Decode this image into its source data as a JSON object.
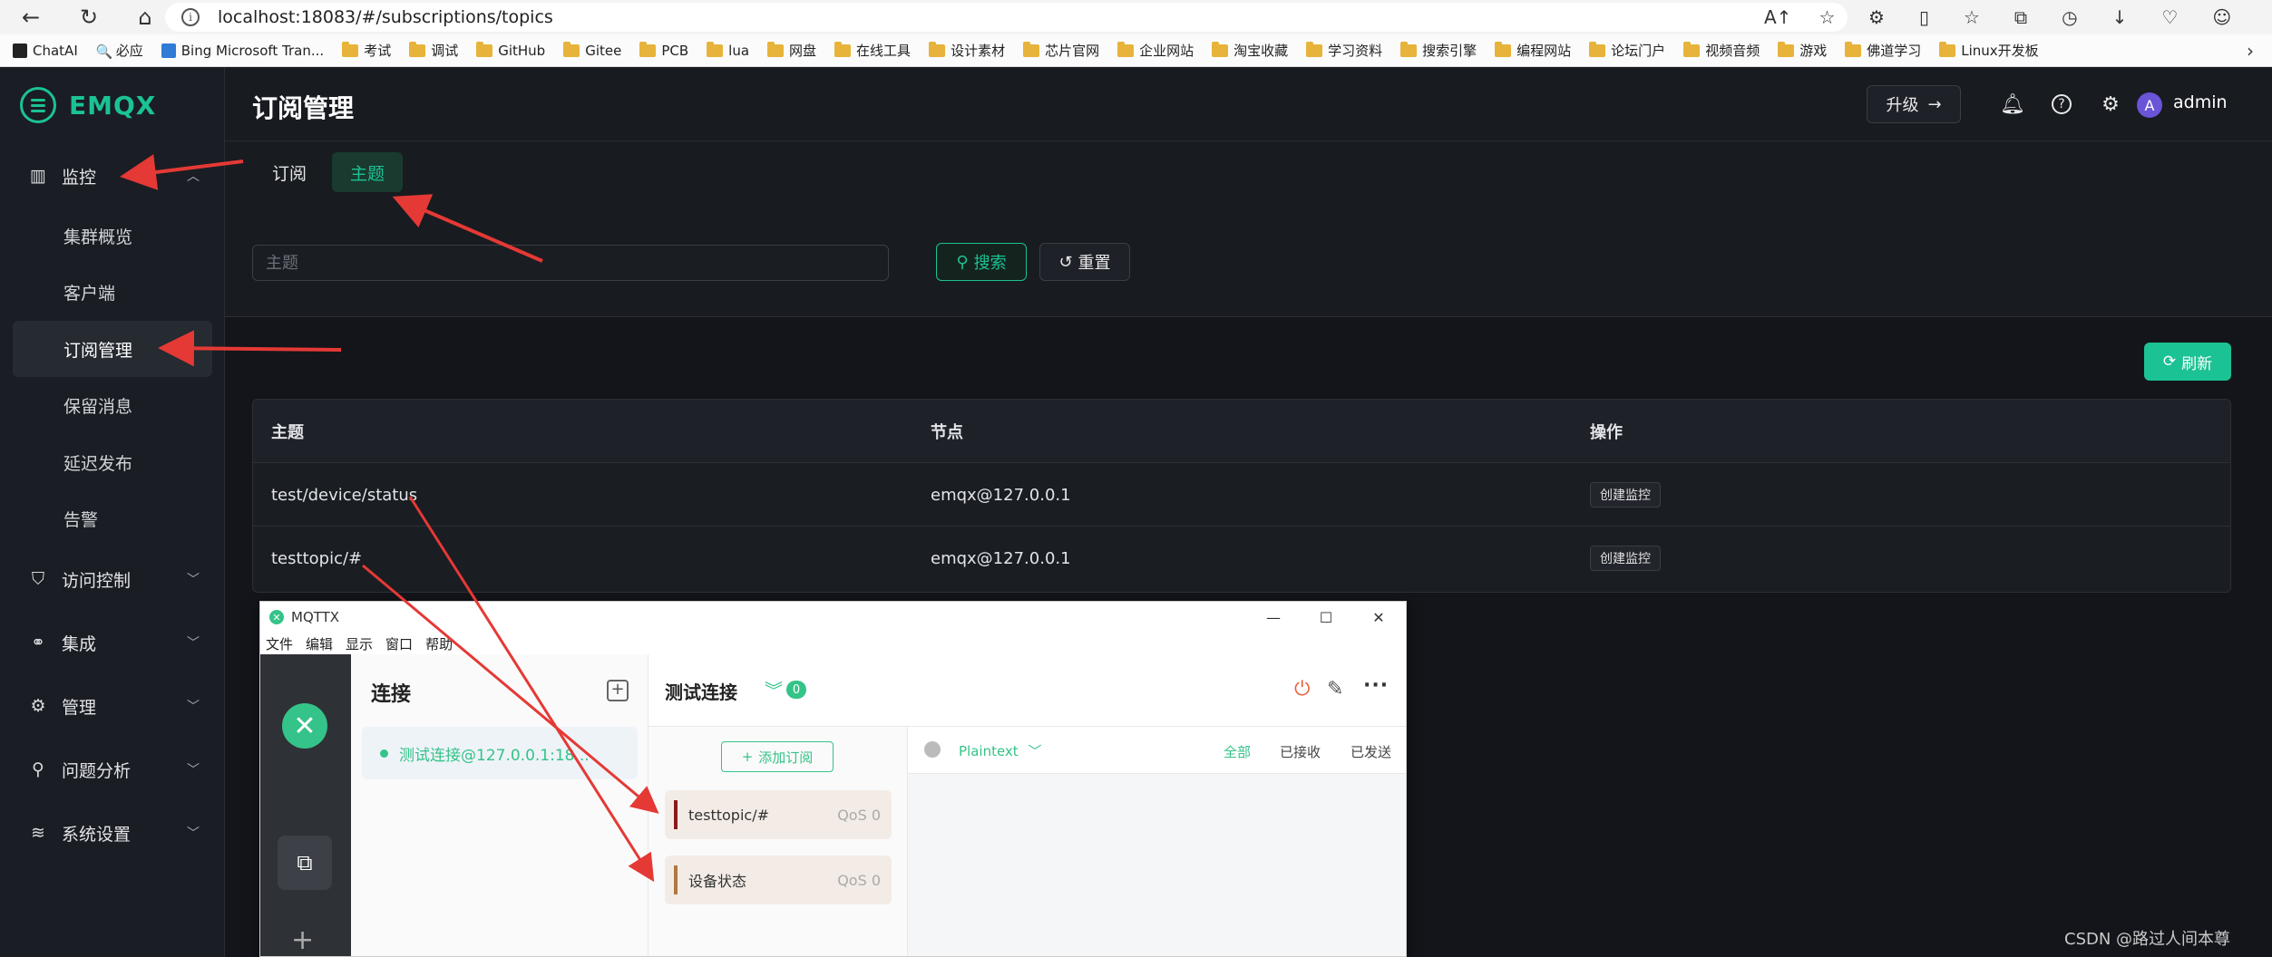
{
  "browser": {
    "url": "localhost:18083/#/subscriptions/topics",
    "bookmarks": [
      "ChatAI",
      "必应",
      "Bing Microsoft Tran...",
      "考试",
      "调试",
      "GitHub",
      "Gitee",
      "PCB",
      "lua",
      "网盘",
      "在线工具",
      "设计素材",
      "芯片官网",
      "企业网站",
      "淘宝收藏",
      "学习资料",
      "搜索引擎",
      "编程网站",
      "论坛门户",
      "视频音频",
      "游戏",
      "佛道学习",
      "Linux开发板"
    ]
  },
  "sidebar": {
    "logo": "EMQX",
    "menu_monitor": "监控",
    "sub_items": [
      "集群概览",
      "客户端",
      "订阅管理",
      "保留消息",
      "延迟发布",
      "告警"
    ],
    "menu_access": "访问控制",
    "menu_integration": "集成",
    "menu_management": "管理",
    "menu_diagnose": "问题分析",
    "menu_settings": "系统设置"
  },
  "header": {
    "title": "订阅管理",
    "upgrade": "升级",
    "avatar_letter": "A",
    "user": "admin"
  },
  "tabs": {
    "subscriptions": "订阅",
    "topics": "主题"
  },
  "search": {
    "placeholder": "主题",
    "search_label": "搜索",
    "reset_label": "重置",
    "refresh_label": "刷新"
  },
  "table": {
    "columns": [
      "主题",
      "节点",
      "操作"
    ],
    "rows": [
      {
        "topic": "test/device/status",
        "node": "emqx@127.0.0.1",
        "action": "创建监控"
      },
      {
        "topic": "testtopic/#",
        "node": "emqx@127.0.0.1",
        "action": "创建监控"
      }
    ]
  },
  "mqttx": {
    "window_title": "MQTTX",
    "menu": [
      "文件",
      "编辑",
      "显示",
      "窗口",
      "帮助"
    ],
    "conn_title": "连接",
    "conn_item": "测试连接@127.0.0.1:18...",
    "head_title": "测试连接",
    "badge": "0",
    "add_sub": "添加订阅",
    "subs": [
      {
        "topic": "testtopic/#",
        "qos": "QoS 0",
        "color": "#8b1a1a"
      },
      {
        "topic": "设备状态",
        "qos": "QoS 0",
        "color": "#b07840"
      }
    ],
    "format": "Plaintext",
    "filters": [
      "全部",
      "已接收",
      "已发送"
    ]
  },
  "watermark": "CSDN @路过人间本尊",
  "colors": {
    "accent": "#1bc293",
    "arrow": "#e53935"
  }
}
